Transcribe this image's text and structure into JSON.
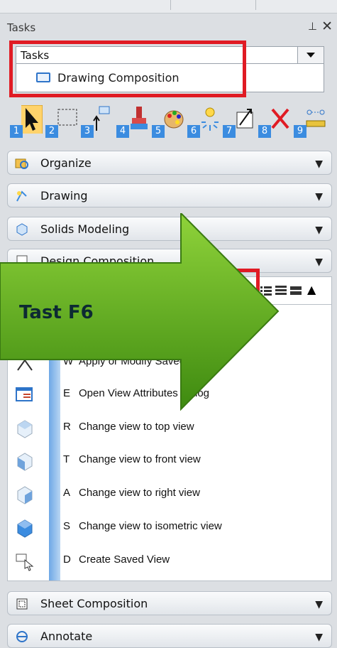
{
  "panel": {
    "title": "Tasks",
    "pin_glyph": "ᵧE",
    "close_glyph": "✕"
  },
  "task_selector": {
    "label": "Tasks",
    "current_task": "Drawing Composition"
  },
  "toolbar": {
    "tools": [
      {
        "number": "1",
        "icon": "select-arrow-icon"
      },
      {
        "number": "2",
        "icon": "marquee-select-icon"
      },
      {
        "number": "3",
        "icon": "place-element-icon"
      },
      {
        "number": "4",
        "icon": "brush-icon"
      },
      {
        "number": "5",
        "icon": "palette-icon"
      },
      {
        "number": "6",
        "icon": "explode-icon"
      },
      {
        "number": "7",
        "icon": "scale-icon"
      },
      {
        "number": "8",
        "icon": "delete-icon"
      },
      {
        "number": "9",
        "icon": "measure-icon"
      }
    ]
  },
  "sections": {
    "organize": "Organize",
    "drawing": "Drawing",
    "solids_modeling": "Solids Modeling",
    "design_composition": "Design Composition",
    "sheet_composition": "Sheet Composition",
    "annotate": "Annotate"
  },
  "items": [
    {
      "key": "W",
      "label": "Apply or Modify Saved View"
    },
    {
      "key": "E",
      "label": "Open View Attributes dialog"
    },
    {
      "key": "R",
      "label": "Change view to top view"
    },
    {
      "key": "T",
      "label": "Change view to front view"
    },
    {
      "key": "A",
      "label": "Change view to right view"
    },
    {
      "key": "S",
      "label": "Change view to isometric view"
    },
    {
      "key": "D",
      "label": "Create Saved View"
    }
  ],
  "overlay": {
    "label": "Tast F6"
  },
  "colors": {
    "highlight_red": "#e01b24",
    "arrow_green": "#5aa81a",
    "accent_blue": "#3b8ce0"
  }
}
